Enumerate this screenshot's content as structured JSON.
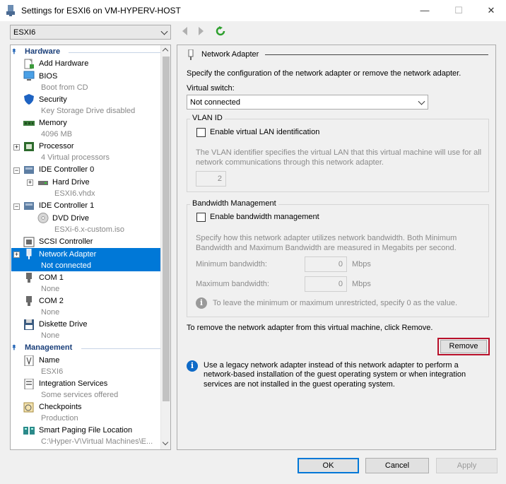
{
  "window": {
    "title": "Settings for ESXI6 on VM-HYPERV-HOST",
    "minimize": "—",
    "maximize": "☐",
    "close": "✕"
  },
  "vm_selector": {
    "value": "ESXI6"
  },
  "tree": {
    "hardware_header": "Hardware",
    "management_header": "Management",
    "items": {
      "add_hardware": {
        "label": "Add Hardware"
      },
      "bios": {
        "label": "BIOS",
        "sub": "Boot from CD"
      },
      "security": {
        "label": "Security",
        "sub": "Key Storage Drive disabled"
      },
      "memory": {
        "label": "Memory",
        "sub": "4096 MB"
      },
      "processor": {
        "label": "Processor",
        "sub": "4 Virtual processors"
      },
      "ide0": {
        "label": "IDE Controller 0"
      },
      "hard_drive": {
        "label": "Hard Drive",
        "sub": "ESXI6.vhdx"
      },
      "ide1": {
        "label": "IDE Controller 1"
      },
      "dvd_drive": {
        "label": "DVD Drive",
        "sub": "ESXi-6.x-custom.iso"
      },
      "scsi": {
        "label": "SCSI Controller"
      },
      "network_adapter": {
        "label": "Network Adapter",
        "sub": "Not connected"
      },
      "com1": {
        "label": "COM 1",
        "sub": "None"
      },
      "com2": {
        "label": "COM 2",
        "sub": "None"
      },
      "diskette": {
        "label": "Diskette Drive",
        "sub": "None"
      },
      "name": {
        "label": "Name",
        "sub": "ESXI6"
      },
      "integration": {
        "label": "Integration Services",
        "sub": "Some services offered"
      },
      "checkpoints": {
        "label": "Checkpoints",
        "sub": "Production"
      },
      "smart_paging": {
        "label": "Smart Paging File Location",
        "sub": "C:\\Hyper-V\\Virtual Machines\\E..."
      }
    }
  },
  "panel": {
    "header": "Network Adapter",
    "description": "Specify the configuration of the network adapter or remove the network adapter.",
    "virtual_switch_label": "Virtual switch:",
    "virtual_switch_value": "Not connected",
    "vlan": {
      "title": "VLAN ID",
      "checkbox_label": "Enable virtual LAN identification",
      "desc1": "The VLAN identifier specifies the virtual LAN that this virtual machine will use for all",
      "desc2": "network communications through this network adapter.",
      "value": "2"
    },
    "bandwidth": {
      "title": "Bandwidth Management",
      "checkbox_label": "Enable bandwidth management",
      "desc1": "Specify how this network adapter utilizes network bandwidth. Both Minimum",
      "desc2": "Bandwidth and Maximum Bandwidth are measured in Megabits per second.",
      "min_label": "Minimum bandwidth:",
      "min_value": "0",
      "max_label": "Maximum bandwidth:",
      "max_value": "0",
      "unit": "Mbps",
      "hint": "To leave the minimum or maximum unrestricted, specify 0 as the value."
    },
    "remove_text": "To remove the network adapter from this virtual machine, click Remove.",
    "remove_button": "Remove",
    "legacy_info_1": "Use a legacy network adapter instead of this network adapter to perform a",
    "legacy_info_2": "network-based installation of the guest operating system or when integration",
    "legacy_info_3": "services are not installed in the guest operating system."
  },
  "footer": {
    "ok": "OK",
    "cancel": "Cancel",
    "apply": "Apply"
  },
  "colors": {
    "accent": "#0078d7",
    "remove_highlight": "#b8102a"
  }
}
